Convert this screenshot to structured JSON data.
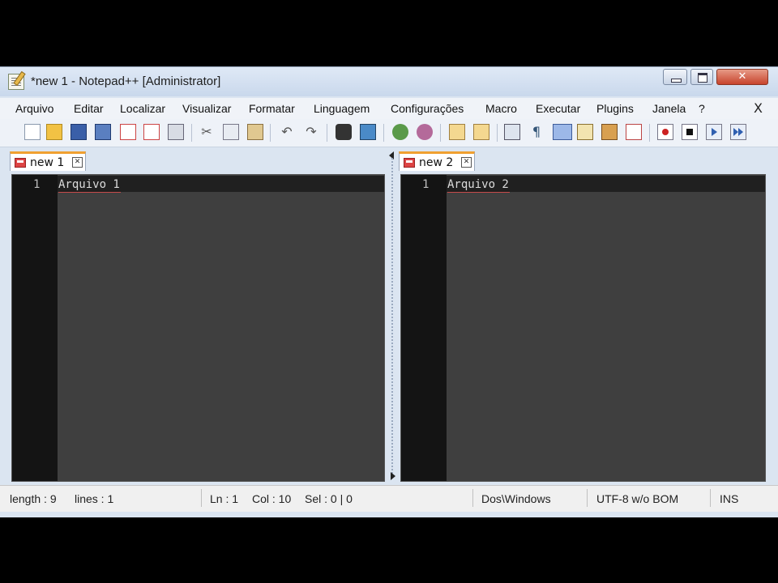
{
  "window": {
    "title": "*new  1 - Notepad++ [Administrator]"
  },
  "menu": {
    "items": [
      "Arquivo",
      "Editar",
      "Localizar",
      "Visualizar",
      "Formatar",
      "Linguagem",
      "Configurações",
      "Macro",
      "Executar",
      "Plugins",
      "Janela",
      "?"
    ],
    "close_label": "X"
  },
  "toolbar": {
    "icons": [
      "new-file-icon",
      "open-file-icon",
      "save-icon",
      "save-all-icon",
      "close-icon",
      "close-all-icon",
      "print-icon",
      "cut-icon",
      "copy-icon",
      "paste-icon",
      "undo-icon",
      "redo-icon",
      "find-icon",
      "replace-icon",
      "zoom-in-icon",
      "zoom-out-icon",
      "sync-vertical-icon",
      "sync-horizontal-icon",
      "word-wrap-icon",
      "show-all-chars-icon",
      "indent-guide-icon",
      "doc-map-icon",
      "function-list-icon",
      "record-macro-icon",
      "stop-record-icon",
      "play-macro-icon",
      "run-macro-multiple-icon"
    ]
  },
  "left_pane": {
    "tab_label": "new  1",
    "line_number": "1",
    "content": "Arquivo 1"
  },
  "right_pane": {
    "tab_label": "new  2",
    "line_number": "1",
    "content": "Arquivo 2"
  },
  "status": {
    "length": "length : 9",
    "lines": "lines : 1",
    "ln": "Ln : 1",
    "col": "Col : 10",
    "sel": "Sel : 0 | 0",
    "eol": "Dos\\Windows",
    "encoding": "UTF-8 w/o BOM",
    "mode": "INS"
  },
  "colors": {
    "editor_bg": "#3f3f3f",
    "gutter_bg": "#141414",
    "tab_accent": "#f0a030",
    "close_button": "#c7442d"
  }
}
